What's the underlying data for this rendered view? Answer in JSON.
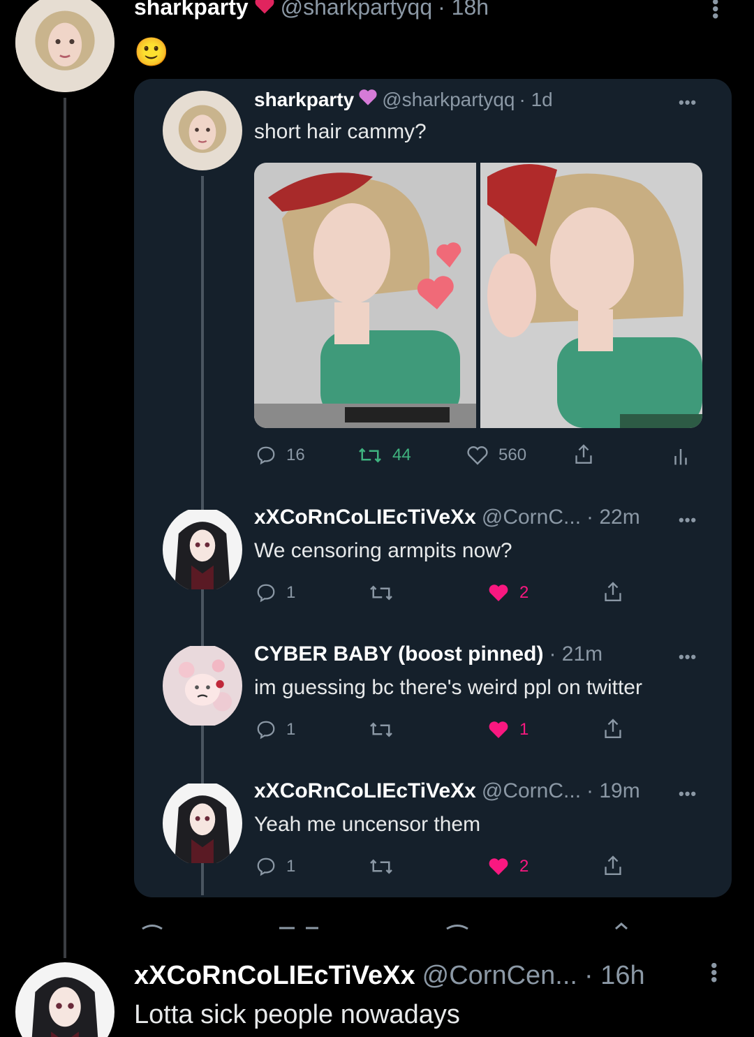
{
  "top_tweet": {
    "display_name": "sharkparty",
    "handle": "@sharkpartyqq",
    "time": "· 18h",
    "emoji": "🙂"
  },
  "quoted": {
    "display_name": "sharkparty",
    "handle": "@sharkpartyqq",
    "time": "· 1d",
    "text": "short hair cammy?",
    "stats": {
      "replies": "16",
      "retweets": "44",
      "likes": "560"
    }
  },
  "replies": [
    {
      "display_name": "xXCoRnCoLIEcTiVeXx",
      "handle": "@CornC...",
      "time": "· 22m",
      "text": "We censoring armpits now?",
      "reply_count": "1",
      "like_count": "2"
    },
    {
      "display_name": "CYBER BABY (boost pinned)",
      "handle": "",
      "time": "· 21m",
      "text": "im guessing bc there's weird ppl on twitter",
      "reply_count": "1",
      "like_count": "1"
    },
    {
      "display_name": "xXCoRnCoLIEcTiVeXx",
      "handle": "@CornC...",
      "time": "· 19m",
      "text": "Yeah me uncensor them",
      "reply_count": "1",
      "like_count": "2"
    }
  ],
  "bottom_tweet": {
    "display_name": "xXCoRnCoLIEcTiVeXx",
    "handle": "@CornCen...",
    "time": "· 16h",
    "text": "Lotta sick people nowadays"
  },
  "colors": {
    "background": "#000000",
    "card": "#15202b",
    "muted": "#8b98a5",
    "like_red": "#f91880",
    "retweet_green": "#00ba7c"
  }
}
